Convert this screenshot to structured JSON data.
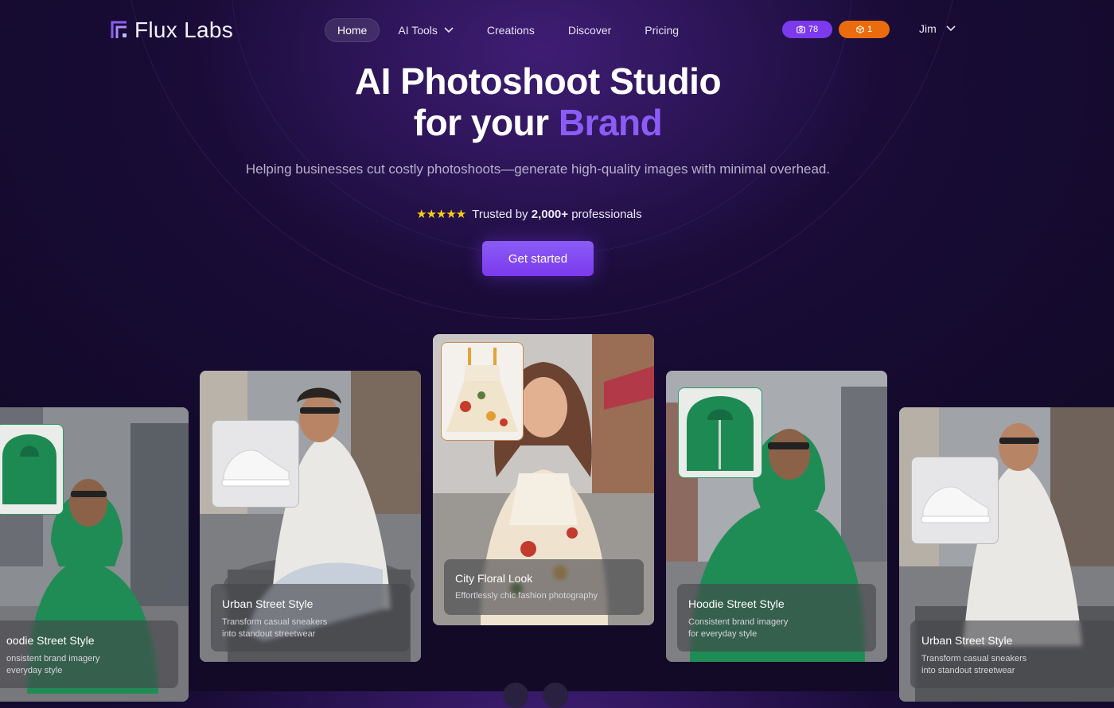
{
  "brand": {
    "name": "Flux Labs"
  },
  "nav": {
    "items": [
      {
        "label": "Home",
        "active": true
      },
      {
        "label": "AI Tools",
        "has_dropdown": true
      },
      {
        "label": "Creations"
      },
      {
        "label": "Discover"
      },
      {
        "label": "Pricing"
      }
    ]
  },
  "badges": {
    "credits": {
      "icon": "camera-icon",
      "value": "78",
      "color": "#7c3aed"
    },
    "models": {
      "icon": "box-icon",
      "value": "1",
      "color": "#ea6c0c"
    }
  },
  "user": {
    "name": "Jim"
  },
  "hero": {
    "title_line1": "AI Photoshoot Studio",
    "title_line2_prefix": "for your ",
    "title_line2_accent": "Brand",
    "subtitle": "Helping businesses cut costly photoshoots—generate high-quality images with minimal overhead.",
    "rating_stars": 5,
    "trust_prefix": "Trusted by ",
    "trust_count": "2,000+",
    "trust_suffix": " professionals",
    "cta": "Get started"
  },
  "cards": [
    {
      "title": "oodie Street Style",
      "desc": "onsistent brand imagery\neveryday style",
      "product": "green hoodie"
    },
    {
      "title": "Urban Street Style",
      "desc": "Transform casual sneakers\ninto standout streetwear",
      "product": "white sneaker"
    },
    {
      "title": "City Floral Look",
      "desc": "Effortlessly chic fashion photography",
      "product": "floral dress"
    },
    {
      "title": "Hoodie Street Style",
      "desc": "Consistent brand imagery\nfor everyday style",
      "product": "green hoodie"
    },
    {
      "title": "Urban Street Style",
      "desc": "Transform casual sneakers\ninto standout streetwear",
      "product": "white sneaker"
    }
  ],
  "colors": {
    "accent": "#8b5cf6",
    "background": "#170b33",
    "star": "#facc15"
  }
}
